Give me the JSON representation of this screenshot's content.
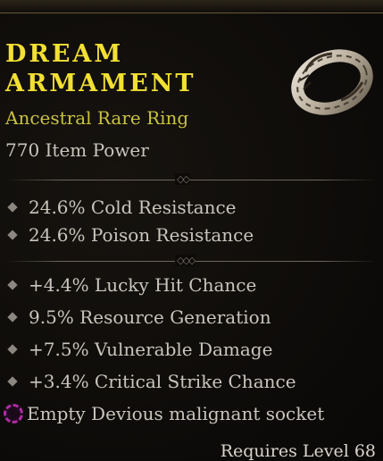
{
  "item": {
    "name": "Dream Armament",
    "name_lines": [
      "DREAM",
      "ARMAMENT"
    ],
    "rarity_type": "Ancestral Rare Ring",
    "item_power": "770 Item Power"
  },
  "implicit_stats": [
    "24.6% Cold Resistance",
    "24.6% Poison Resistance"
  ],
  "affixes": [
    "+4.4% Lucky Hit Chance",
    "9.5% Resource Generation",
    "+7.5% Vulnerable Damage",
    "+3.4% Critical Strike Chance"
  ],
  "socket": {
    "label": "Empty Devious malignant socket",
    "icon": "malignant-socket-icon",
    "color": "#b02ba6"
  },
  "requirement": "Requires Level 68",
  "colors": {
    "title": "#f2e033",
    "subtitle": "#c9c240",
    "text": "#c9c5bd"
  }
}
